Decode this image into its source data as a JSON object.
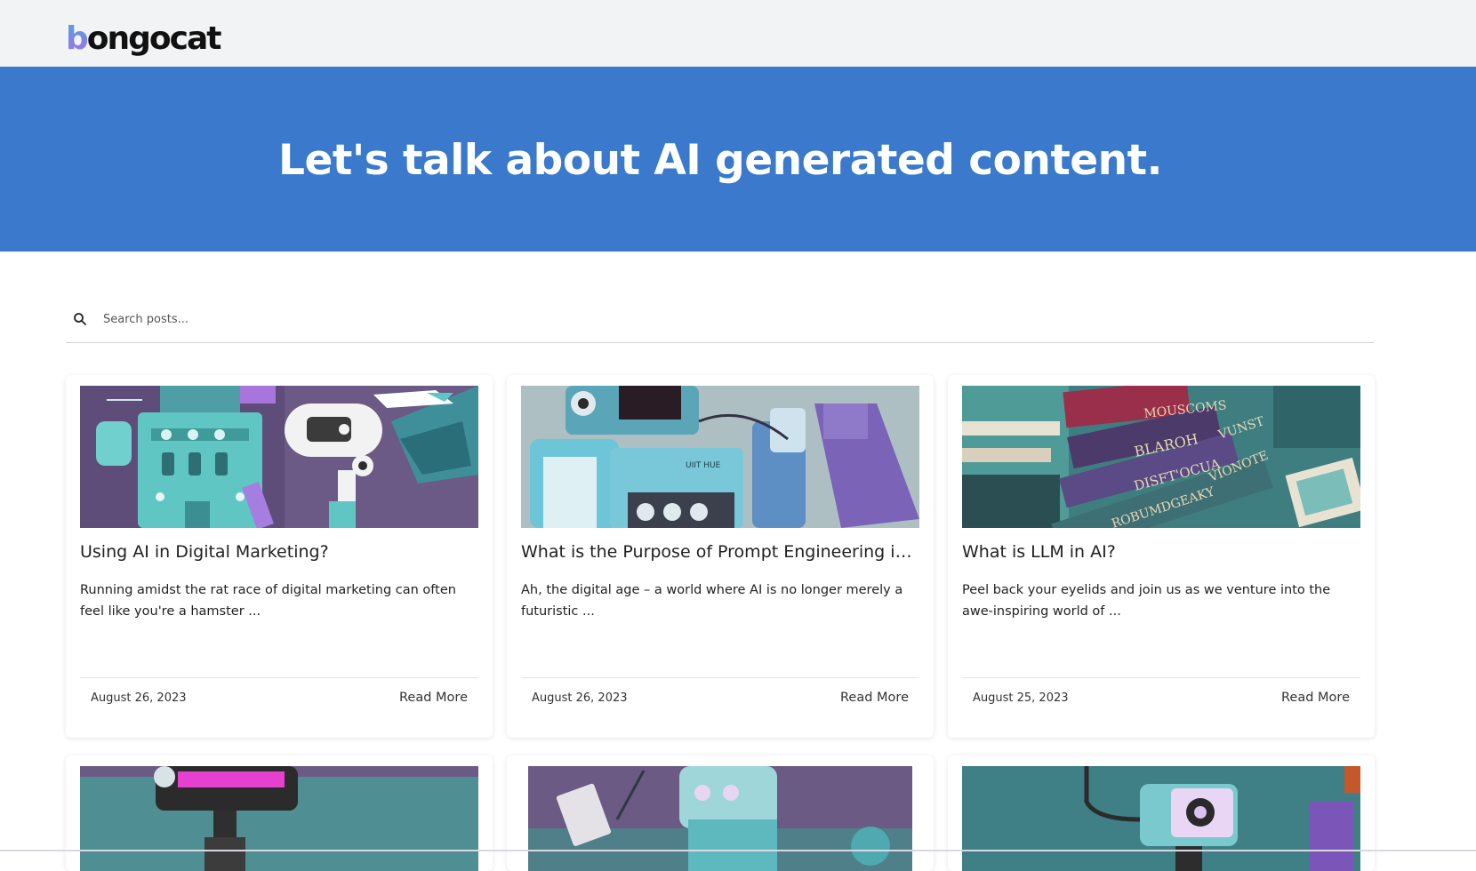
{
  "header": {
    "logo_text": "bongocat",
    "logo_first": "b",
    "logo_rest": "ongocat"
  },
  "hero": {
    "title": "Let's talk about AI generated content.",
    "background": "#3a79cb"
  },
  "search": {
    "placeholder": "Search posts..."
  },
  "posts": [
    {
      "title": "Using AI in Digital Marketing?",
      "excerpt": "Running amidst the rat race of digital marketing can often feel like you're a hamster ...",
      "date": "August 26, 2023",
      "cta": "Read More"
    },
    {
      "title": "What is the Purpose of Prompt Engineering in G...",
      "excerpt": "Ah, the digital age – a world where AI is no longer merely a futuristic ...",
      "date": "August 26, 2023",
      "cta": "Read More",
      "image_text": "UIIT HUE"
    },
    {
      "title": "What is LLM in AI?",
      "excerpt": "Peel back your eyelids and join us as we venture into the awe-inspiring world of ...",
      "date": "August 25, 2023",
      "cta": "Read More",
      "image_text": [
        "MOUSCOMS",
        "BLAROH",
        "VUNST",
        "DISFT'OCUA",
        "VIONOTE",
        "ROBUMDGEAKY"
      ]
    },
    {
      "title": "",
      "excerpt": "",
      "date": "",
      "cta": ""
    },
    {
      "title": "",
      "excerpt": "",
      "date": "",
      "cta": ""
    },
    {
      "title": "",
      "excerpt": "",
      "date": "",
      "cta": ""
    }
  ]
}
